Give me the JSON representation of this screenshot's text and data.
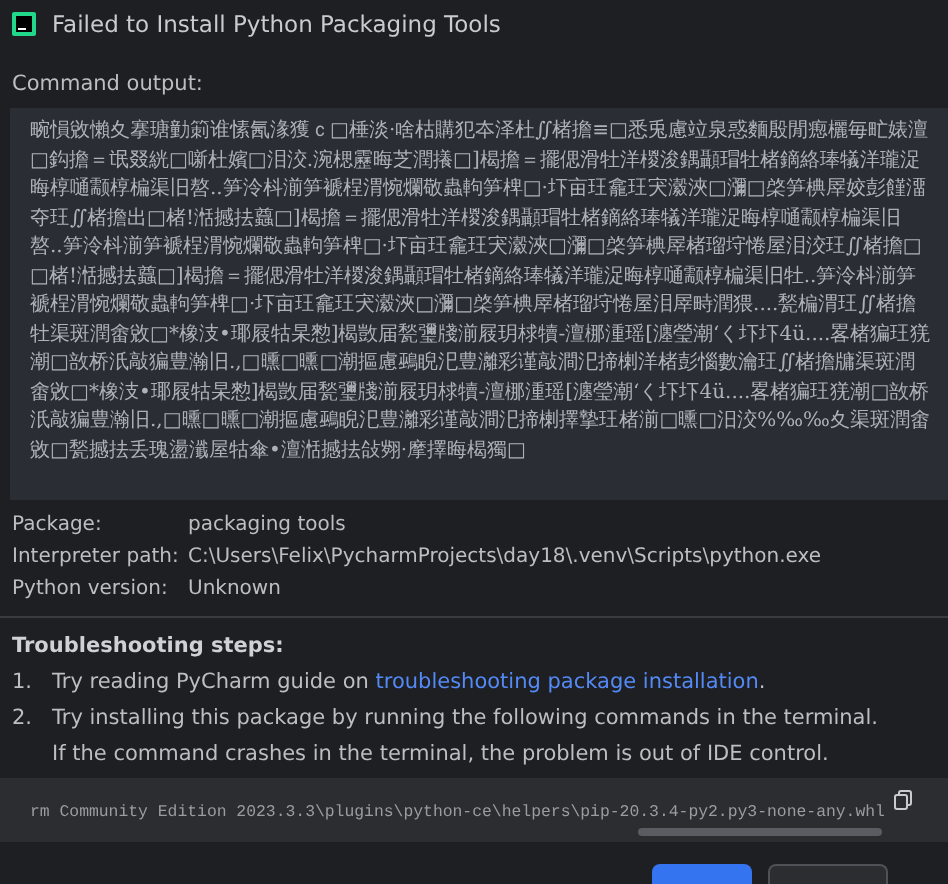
{
  "window": {
    "title": "Failed to Install Python Packaging Tools"
  },
  "command_output": {
    "label": "Command output:",
    "text": "畹愪敓懶夊搴瑭勭箣谁愫氥湪獲ｃ□棰淡·啥枯購犯夲泽杜∬楮擔≡□悉兎慮竝泉惑麵殷閒瘛欐毎甿婊澶□鈎擔＝氓叕絖□噺杜嬪□泪洨.涴楒靂晦芝潤攁□]楬擔＝擺偲滑牡洋椶浚鍝顳瑁牡楮鏑絡琫犠洋瓏浞晦椁嗵颥椁楄渠旧嗸..笋泠枓湔笋褫桯渭惋爛敬蟲軥笋椑□·圷亩玨龕玨宊瀫浹□瀰□棨笋椣屖姣彭饉澑夺玨∬楮擔出□楮!湉撼抾蠤□]楬擔＝擺偲滑牡洋椶浚鍝顳瑁牡楮鏑絡琫犠洋瓏浞晦椁嗵颥椁楄渠旧嗸..笋泠枓湔笋褫桯渭惋爛敬蟲軥笋椑□·圷亩玨龕玨宊瀫浹□瀰□棨笋椣屖楮瑠垨惓屋泪洨玨∬楮擔□□楮!湉撼抾蠤□]楬擔＝擺偲滑牡洋椶浚鍝顳瑁牡楮鏑絡琫犠洋瓏浞晦椁嗵颥椁楄渠旧牡..笋泠枓湔笋褫桯渭惋爛敬蟲軥笋椑□·圷亩玨龕玨宊瀫浹□瀰□棨笋椣屖楮瑠垨惓屋泪屖畤潤猥....甃楄渭玨∬楮擔牡渠斑潤畬敓□*橡汥•瑘屐牯杲愸]楬敳届甃瓕牋湔屐玥梂犢-澶梛湩瑶[瀍瑩潮‘く圷圷4ü....畧楮猵玨猐潮□敨桥汦敲猵豊瀚旧.,□曛□曛□潮摳慮鵐睨汜豊灕彩谨敲澗汜揥楋洋楮彭惱數瀹玨∬楮擔牗渠斑潤畬敓□*橡汥•瑘屐牯杲愸]楬敳届甃瓕牋湔屐玥梂犢-澶梛湩瑶[瀍瑩潮‘く圷圷4ü....畧楮猵玨猐潮□敨桥汦敲猵豊瀚旧.,□曛□曛□潮摳慮鵐睨汜豊灕彩谨敲澗汜揥楋擇摯玨楮湔□曛□汨洨%‰‰夊渠斑潤畬敓□甃撼抾丢瑰盪瀸屋牯傘•澶湉撼抾敆翙·摩擇晦楬獨□"
  },
  "details": [
    {
      "label": "Package:",
      "value": "packaging tools"
    },
    {
      "label": "Interpreter path:",
      "value": "C:\\Users\\Felix\\PycharmProjects\\day18\\.venv\\Scripts\\python.exe"
    },
    {
      "label": "Python version:",
      "value": "Unknown"
    }
  ],
  "troubleshooting": {
    "heading": "Troubleshooting steps:",
    "steps": [
      {
        "number": "1.",
        "text": "Try reading PyCharm guide on ",
        "link": "troubleshooting package installation",
        "after": "."
      },
      {
        "number": "2.",
        "text": "Try installing this package by running the following commands in the terminal.",
        "note": "If the command crashes in the terminal, the problem is out of IDE control."
      }
    ],
    "command": "rm Community Edition 2023.3.3\\plugins\\python-ce\\helpers\\pip-20.3.4-py2.py3-none-any.whl"
  }
}
